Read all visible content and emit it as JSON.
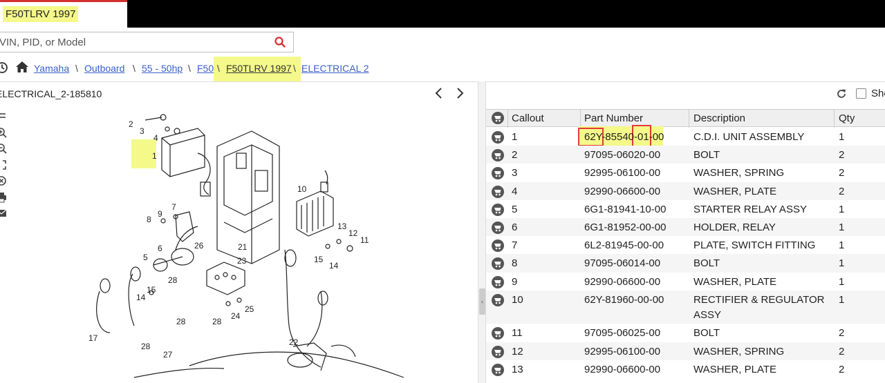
{
  "tab": {
    "title": "F50TLRV 1997"
  },
  "search": {
    "placeholder": "VIN, PID, or Model"
  },
  "breadcrumb": [
    {
      "label": "Yamaha"
    },
    {
      "label": "Outboard"
    },
    {
      "label": "55 - 50hp"
    },
    {
      "label": "F50"
    },
    {
      "label": "F50TLRV 1997"
    },
    {
      "label": "ELECTRICAL 2"
    }
  ],
  "diagram": {
    "title": "ELECTRICAL_2-185810",
    "callouts": [
      "1",
      "2",
      "3",
      "4",
      "5",
      "6",
      "7",
      "8",
      "9",
      "10",
      "11",
      "12",
      "13",
      "14",
      "15",
      "21",
      "22",
      "23",
      "24",
      "25",
      "26",
      "27",
      "28"
    ]
  },
  "parts_panel": {
    "show_label": "Sho",
    "columns": {
      "callout": "Callout",
      "part_number": "Part Number",
      "description": "Description",
      "qty": "Qty"
    },
    "rows": [
      {
        "callout": "1",
        "part_number": "62Y-85540-01-00",
        "description": "C.D.I. UNIT ASSEMBLY",
        "qty": "1"
      },
      {
        "callout": "2",
        "part_number": "97095-06020-00",
        "description": "BOLT",
        "qty": "2"
      },
      {
        "callout": "3",
        "part_number": "92995-06100-00",
        "description": "WASHER, SPRING",
        "qty": "2"
      },
      {
        "callout": "4",
        "part_number": "92990-06600-00",
        "description": "WASHER, PLATE",
        "qty": "2"
      },
      {
        "callout": "5",
        "part_number": "6G1-81941-10-00",
        "description": "STARTER RELAY ASSY",
        "qty": "1"
      },
      {
        "callout": "6",
        "part_number": "6G1-81952-00-00",
        "description": "HOLDER, RELAY",
        "qty": "1"
      },
      {
        "callout": "7",
        "part_number": "6L2-81945-00-00",
        "description": "PLATE, SWITCH FITTING",
        "qty": "1"
      },
      {
        "callout": "8",
        "part_number": "97095-06014-00",
        "description": "BOLT",
        "qty": "1"
      },
      {
        "callout": "9",
        "part_number": "92990-06600-00",
        "description": "WASHER, PLATE",
        "qty": "1"
      },
      {
        "callout": "10",
        "part_number": "62Y-81960-00-00",
        "description": "RECTIFIER & REGULATOR ASSY",
        "qty": "1"
      },
      {
        "callout": "11",
        "part_number": "97095-06025-00",
        "description": "BOLT",
        "qty": "2"
      },
      {
        "callout": "12",
        "part_number": "92995-06100-00",
        "description": "WASHER, SPRING",
        "qty": "2"
      },
      {
        "callout": "13",
        "part_number": "92990-06600-00",
        "description": "WASHER, PLATE",
        "qty": "2"
      }
    ]
  },
  "colors": {
    "highlight": "#f4f98a",
    "link": "#3a60c9",
    "redbox": "#e53935",
    "tab_accent": "#d32f2f"
  }
}
